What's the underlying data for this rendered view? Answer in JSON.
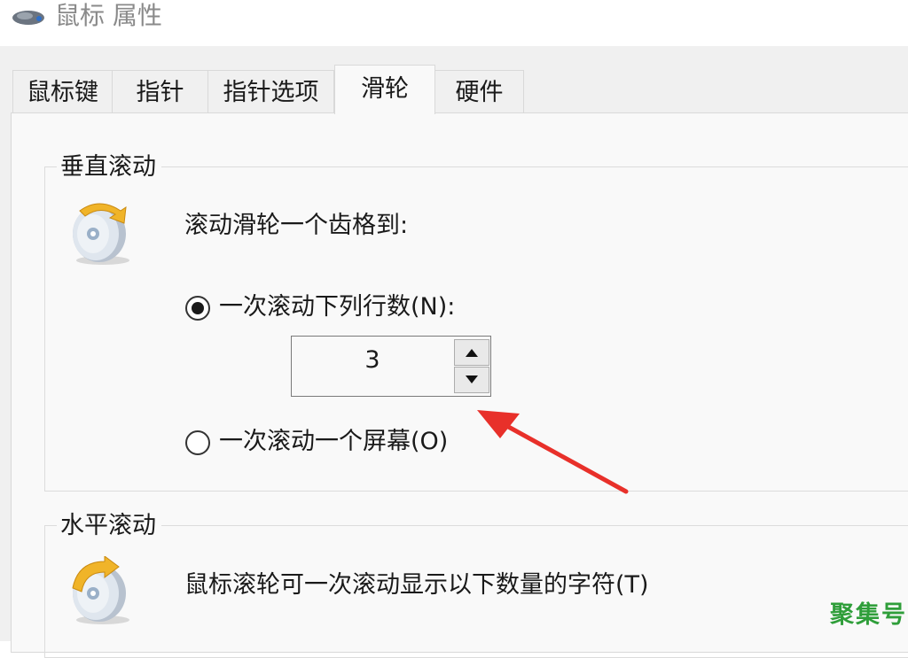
{
  "window": {
    "title": "鼠标 属性",
    "icon": "mouse-icon"
  },
  "tabs": [
    {
      "label": "鼠标键",
      "active": false
    },
    {
      "label": "指针",
      "active": false
    },
    {
      "label": "指针选项",
      "active": false
    },
    {
      "label": "滑轮",
      "active": true
    },
    {
      "label": "硬件",
      "active": false
    }
  ],
  "vertical_scroll": {
    "legend": "垂直滚动",
    "icon": "scroll-wheel-vertical-icon",
    "description": "滚动滑轮一个齿格到:",
    "option_lines": {
      "label": "一次滚动下列行数(N):",
      "selected": true
    },
    "lines_value": "3",
    "option_screen": {
      "label": "一次滚动一个屏幕(O)",
      "selected": false
    }
  },
  "horizontal_scroll": {
    "legend": "水平滚动",
    "icon": "scroll-wheel-horizontal-icon",
    "description": "鼠标滚轮可一次滚动显示以下数量的字符(T)"
  },
  "annotation": {
    "arrow_color": "#e8302a"
  },
  "watermark": "聚集号",
  "colors": {
    "accent": "#1a1a1a",
    "watermark": "#2f9e3a",
    "dialog_bg": "#f0f0f0",
    "panel_bg": "#f9f9f9"
  }
}
